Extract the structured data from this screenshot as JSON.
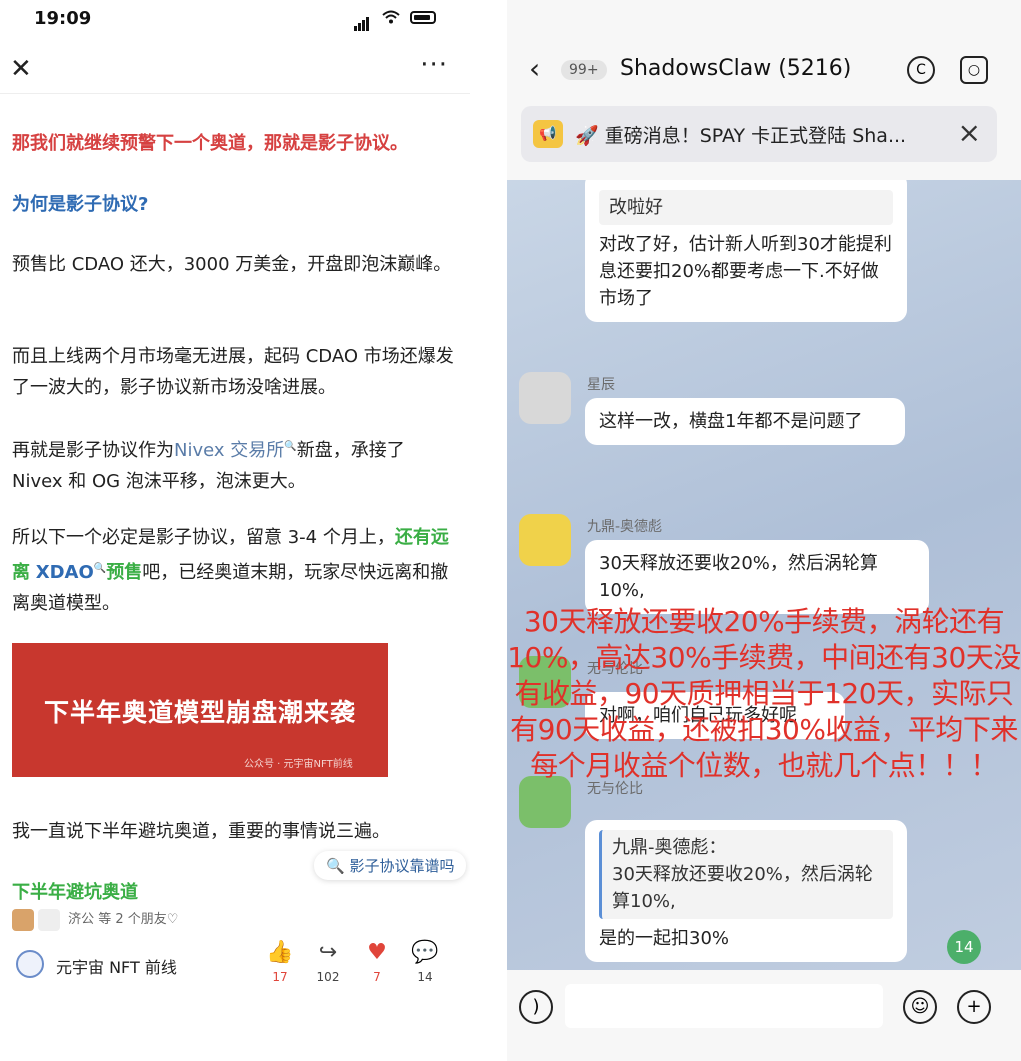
{
  "status": {
    "time": "19:09"
  },
  "article": {
    "p1": "那我们就继续预警下一个奥道，那就是影子协议。",
    "h1": "为何是影子协议?",
    "p2": "预售比 CDAO 还大，3000 万美金，开盘即泡沫巅峰。",
    "p3": "而且上线两个月市场毫无进展，起码 CDAO 市场还爆发了一波大的，影子协议新市场没啥进展。",
    "p4a": "再就是影子协议作为",
    "p4link": "Nivex 交易所",
    "p4b": "新盘，承接了 Nivex 和 OG 泡沫平移，泡沫更大。",
    "p5a": "所以下一个必定是影子协议，留意 3-4 个月上，",
    "p5g1": "还有远离",
    "p5g2": "XDAO",
    "p5g3": "预售",
    "p5b": "吧，已经奥道末期，玩家尽快远离和撤离奥道模型。",
    "banner_title": "下半年奥道模型崩盘潮来袭",
    "banner_wm": "公众号 · 元宇宙NFT前线",
    "p6": "我一直说下半年避坑奥道，重要的事情说三遍。",
    "search_chip": "影子协议靠谱吗",
    "h2": "下半年避坑奥道",
    "friends": "济公 等 2 个朋友♡"
  },
  "account": {
    "name": "元宇宙 NFT 前线"
  },
  "actions": [
    {
      "icon": "like-icon",
      "count": "17",
      "color": "#e0453a"
    },
    {
      "icon": "share-icon",
      "count": "102",
      "color": "#444444"
    },
    {
      "icon": "heart-icon",
      "count": "7",
      "color": "#e0453a"
    },
    {
      "icon": "comment-icon",
      "count": "14",
      "color": "#444444"
    }
  ],
  "chat": {
    "badge": "99+",
    "title": "ShadowsClaw (5216)",
    "notice": "🚀 重磅消息！SPAY 卡正式登陆 Sha...",
    "m1_quote": "改啦好",
    "m1_text": "对改了好，估计新人听到30才能提利息还要扣20%都要考虑一下.不好做市场了",
    "m2_name": "星辰",
    "m2_text": "这样一改，横盘1年都不是问题了",
    "m3_name": "九鼎-奥德彪",
    "m3_text": "30天释放还要收20%，然后涡轮算10%,",
    "m4_name": "无与伦比",
    "m4_text": "对啊，咱们自己玩多好呢",
    "m5_name": "无与伦比",
    "m5_quote_name": "九鼎-奥德彪：",
    "m5_quote": "30天释放还要收20%，然后涡轮算10%,",
    "m5_text": "是的一起扣30%",
    "unread": "14"
  },
  "overlay_text": "30天释放还要收20%手续费，涡轮还有10%，高达30%手续费，中间还有30天没有收益，90天质押相当于120天，实际只有90天收益，还被扣30%收益，平均下来每个月收益个位数，也就几个点！！！",
  "colors": {
    "red_text": "#d64141",
    "blue_heading": "#2f6bb3",
    "green_text": "#3aae45",
    "banner": "#c8372e",
    "overlay": "#e0312a"
  }
}
